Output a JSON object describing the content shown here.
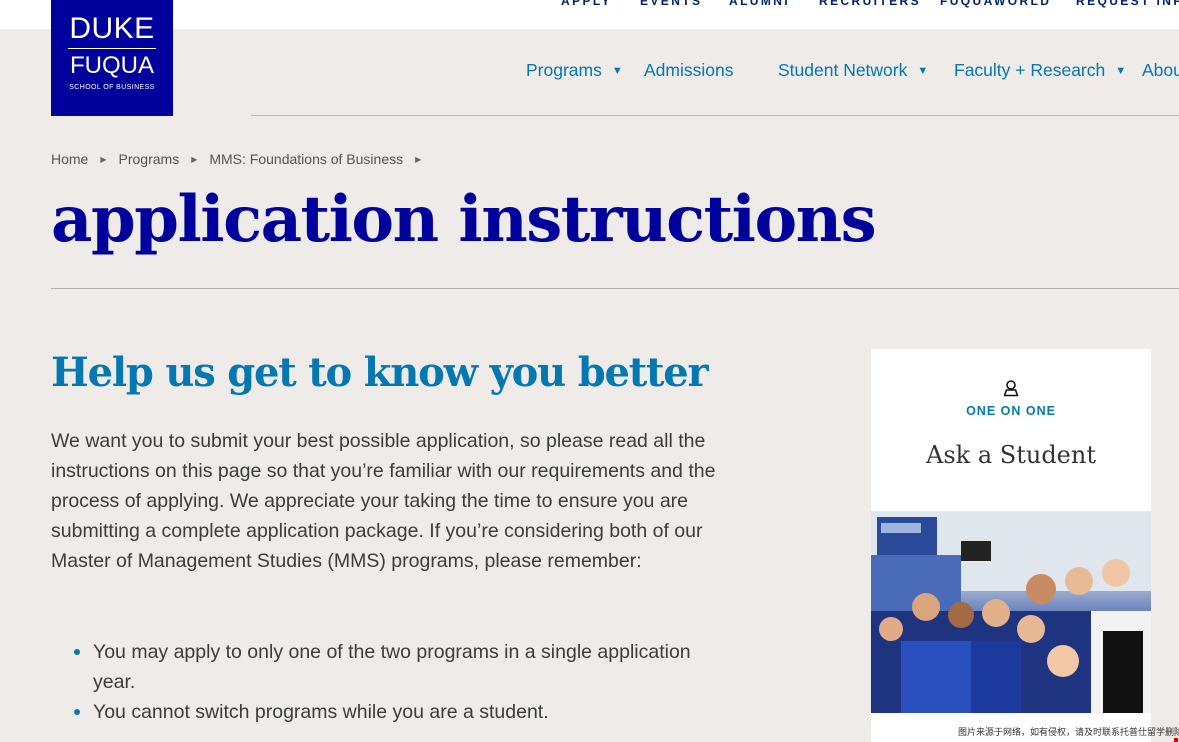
{
  "utility_nav": [
    "APPLY",
    "EVENTS",
    "ALUMNI",
    "RECRUITERS",
    "FUQUAWORLD",
    "REQUEST INFO"
  ],
  "logo": {
    "line1": "DUKE",
    "line2": "FUQUA",
    "line3": "SCHOOL OF BUSINESS",
    "color": "#00009c"
  },
  "main_nav": [
    {
      "label": "Programs",
      "has_dropdown": true
    },
    {
      "label": "Admissions",
      "has_dropdown": false
    },
    {
      "label": "Student Network",
      "has_dropdown": true
    },
    {
      "label": "Faculty + Research",
      "has_dropdown": true
    },
    {
      "label": "About",
      "has_dropdown": false
    }
  ],
  "breadcrumb": [
    "Home",
    "Programs",
    "MMS: Foundations of Business"
  ],
  "page_title": "application instructions",
  "section": {
    "heading": "Help us get to know you better",
    "intro": "We want you to submit your best possible application, so please read all the instructions on this page so that you’re familiar with our requirements and the process of applying. We appreciate your taking the time to ensure you are submitting a complete application package.  If you’re considering both of our Master of Management Studies (MMS) programs, please remember:",
    "bullets": [
      "You may apply to only one of the two programs in a single application year.",
      "You cannot switch programs while you are a student."
    ]
  },
  "card": {
    "icon": "person-icon",
    "kicker": "ONE ON ONE",
    "title": "Ask a Student"
  },
  "watermark": "图片来源于网络，如有侵权，请及时联系托普仕留学删除",
  "colors": {
    "navy": "#00009c",
    "accent_blue": "#0577b1",
    "page_bg": "#eeebe8"
  }
}
